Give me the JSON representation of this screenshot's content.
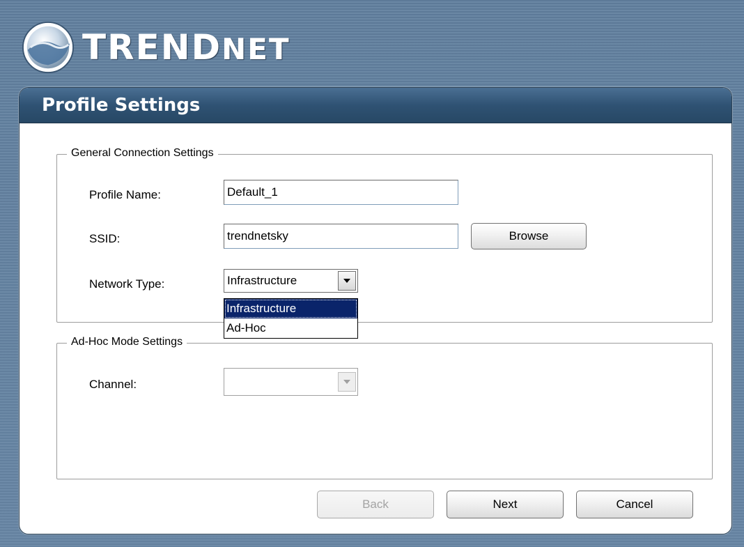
{
  "brand": {
    "name_main": "TREND",
    "name_suffix": "NET"
  },
  "window": {
    "title": "Profile Settings"
  },
  "general": {
    "legend": "General Connection Settings",
    "profile_name_label": "Profile Name:",
    "profile_name_value": "Default_1",
    "ssid_label": "SSID:",
    "ssid_value": "trendnetsky",
    "browse_label": "Browse",
    "network_type_label": "Network Type:",
    "network_type_value": "Infrastructure",
    "network_type_options": [
      "Infrastructure",
      "Ad-Hoc"
    ]
  },
  "adhoc": {
    "legend": "Ad-Hoc Mode Settings",
    "channel_label": "Channel:",
    "channel_value": ""
  },
  "footer": {
    "back_label": "Back",
    "next_label": "Next",
    "cancel_label": "Cancel"
  },
  "colors": {
    "header": "#2f5273",
    "selection": "#0a246a",
    "background": "#5d7a98"
  },
  "icons": {
    "logo": "trendnet-globe-icon",
    "dropdown": "chevron-down-icon"
  }
}
